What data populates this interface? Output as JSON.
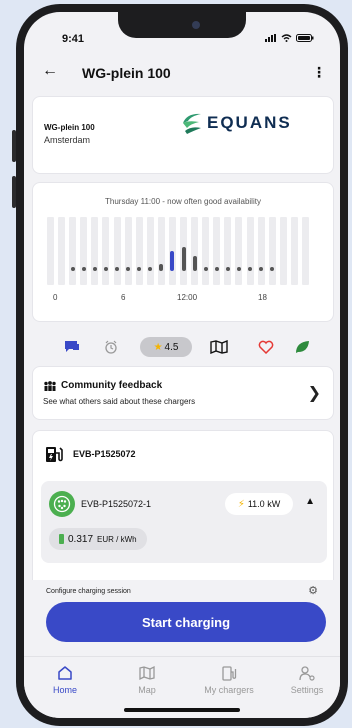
{
  "status": {
    "time": "9:41"
  },
  "header": {
    "title": "WG-plein 100"
  },
  "location": {
    "name": "WG-plein 100",
    "city": "Amsterdam",
    "brand": "EQUANS"
  },
  "availability": {
    "text": "Thursday 11:00 - now often good availability",
    "x_labels": [
      "0",
      "6",
      "12:00",
      "18"
    ]
  },
  "chart_data": {
    "type": "bar",
    "categories": [
      "0",
      "1",
      "2",
      "3",
      "4",
      "5",
      "6",
      "7",
      "8",
      "9",
      "10",
      "11",
      "12",
      "13",
      "14",
      "15",
      "16",
      "17",
      "18",
      "19",
      "20",
      "21",
      "22",
      "23"
    ],
    "values": [
      0,
      0,
      0,
      0,
      0,
      0,
      0,
      0,
      0,
      0.05,
      0.15,
      0.45,
      0.55,
      0.35,
      0.1,
      0,
      0,
      0,
      0,
      0,
      0,
      0,
      0,
      0
    ],
    "highlight_index": 11,
    "colors": {
      "bar": "#555555",
      "highlight": "#3949c7",
      "track": "#ececef"
    }
  },
  "actions": {
    "rating": "4.5"
  },
  "community": {
    "title": "Community feedback",
    "subtitle": "See what others said about these chargers"
  },
  "charger": {
    "id": "EVB-P1525072",
    "connector": {
      "id": "EVB-P1525072-1",
      "power": "11.0 kW",
      "price": "0.317",
      "price_unit": "EUR / kWh"
    }
  },
  "configure": {
    "label": "Configure charging session"
  },
  "start_button": {
    "label": "Start charging"
  },
  "tabs": [
    {
      "label": "Home",
      "icon": "home-icon",
      "active": true
    },
    {
      "label": "Map",
      "icon": "map-icon"
    },
    {
      "label": "My chargers",
      "icon": "charger-icon"
    },
    {
      "label": "Settings",
      "icon": "settings-icon"
    }
  ],
  "colors": {
    "accent": "#3949c7",
    "connector": "#4caf50",
    "heart": "#e53935",
    "leaf": "#2e8b3d",
    "star": "#f5b400"
  }
}
